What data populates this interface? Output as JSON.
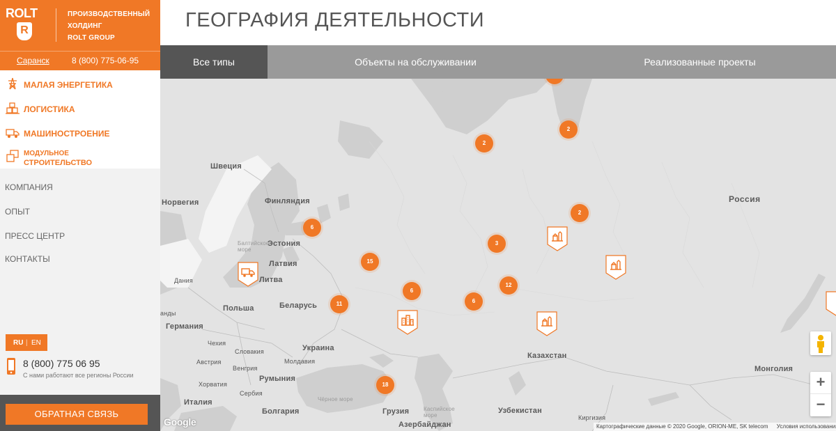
{
  "brand": {
    "logo_word": "ROLT",
    "logo_letter": "R",
    "tagline": [
      "ПРОИЗВОДСТВЕННЫЙ",
      "ХОЛДИНГ",
      "ROLT GROUP"
    ]
  },
  "contact_bar": {
    "city": "Саранск",
    "phone": "8 (800) 775-06-95"
  },
  "divisions": [
    {
      "label": "МАЛАЯ ЭНЕРГЕТИКА",
      "icon": "power-tower-icon"
    },
    {
      "label": "ЛОГИСТИКА",
      "icon": "warehouse-icon"
    },
    {
      "label": "МАШИНОСТРОЕНИЕ",
      "icon": "truck-icon"
    },
    {
      "label": "МОДУЛЬНОЕ",
      "label2": "СТРОИТЕЛЬСТВО",
      "icon": "modules-icon"
    }
  ],
  "menu": [
    "КОМПАНИЯ",
    "ОПЫТ",
    "ПРЕСС ЦЕНТР",
    "КОНТАКТЫ"
  ],
  "lang": {
    "ru": "RU",
    "sep": "|",
    "en": "EN"
  },
  "phone_block": {
    "number": "8 (800) 775 06 95",
    "note": "С нами работают все регионы России"
  },
  "feedback": {
    "label": "ОБРАТНАЯ СВЯЗЬ"
  },
  "page": {
    "title": "ГЕОГРАФИЯ ДЕЯТЕЛЬНОСТИ"
  },
  "tabs": [
    {
      "label": "Все типы",
      "active": true
    },
    {
      "label": "Объекты на обслуживании",
      "active": false
    },
    {
      "label": "Реализованные проекты",
      "active": false
    }
  ],
  "map": {
    "place_labels": {
      "russia": "Россия",
      "sweden": "Швеция",
      "norway": "Норвегия",
      "finland": "Финляндия",
      "estonia": "Эстония",
      "latvia": "Латвия",
      "lithuania": "Литва",
      "baltic_sea": "Балтийское море",
      "denmark": "Дания",
      "belarus": "Беларусь",
      "poland": "Польша",
      "germany": "Германия",
      "netherlands": "анды",
      "czechia": "Чехия",
      "slovakia": "Словакия",
      "austria": "Австрия",
      "hungary": "Венгрия",
      "moldova": "Молдавия",
      "ukraine": "Украина",
      "croatia": "Хорватия",
      "serbia": "Сербия",
      "romania": "Румыния",
      "italy": "Италия",
      "bulgaria": "Болгария",
      "black_sea": "Чёрное море",
      "georgia": "Грузия",
      "caspian_sea": "Каспийское море",
      "azerbaijan": "Азербайджан",
      "uzbekistan": "Узбекистан",
      "kyrgyzstan": "Киргизия",
      "kazakhstan": "Казахстан",
      "mongolia": "Монголия"
    },
    "clusters": [
      "2",
      "2",
      "2",
      "6",
      "3",
      "15",
      "12",
      "6",
      "6",
      "11",
      "18"
    ],
    "pins": [
      "power-plant-icon",
      "power-plant-icon",
      "power-plant-icon",
      "truck-icon",
      "factory-icon"
    ],
    "attribution": {
      "data": "Картографические данные © 2020 Google, ORION-ME, SK telecom",
      "terms": "Условия использования"
    },
    "google_logo": "Google",
    "controls": {
      "zoom_in": "+",
      "zoom_out": "−"
    },
    "colors": {
      "accent": "#f07826",
      "land": "#e3e3e3",
      "water": "#cfcfcf"
    }
  }
}
